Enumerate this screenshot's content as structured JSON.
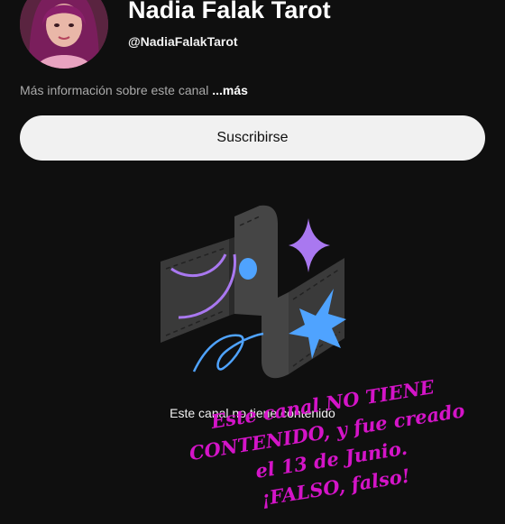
{
  "channel": {
    "name": "Nadia Falak Tarot",
    "handle": "@NadiaFalakTarot",
    "about_text": "Más información sobre este canal",
    "about_more": "...más",
    "subscribe_label": "Suscribirse"
  },
  "empty_state": {
    "message": "Este canal no tiene contenido",
    "illustration": "empty-channel-illustration"
  },
  "overlay_note": {
    "line1": "Este canal NO TIENE",
    "line2": "CONTENIDO, y fue creado",
    "line3": "el 13 de Junio.",
    "line4": "¡FALSO, falso!"
  },
  "colors": {
    "background": "#0f0f0f",
    "subscribe_bg": "#f1f1f1",
    "overlay_text": "#d414c8",
    "accent_purple": "#a978f0",
    "accent_blue": "#4fa3ff"
  }
}
